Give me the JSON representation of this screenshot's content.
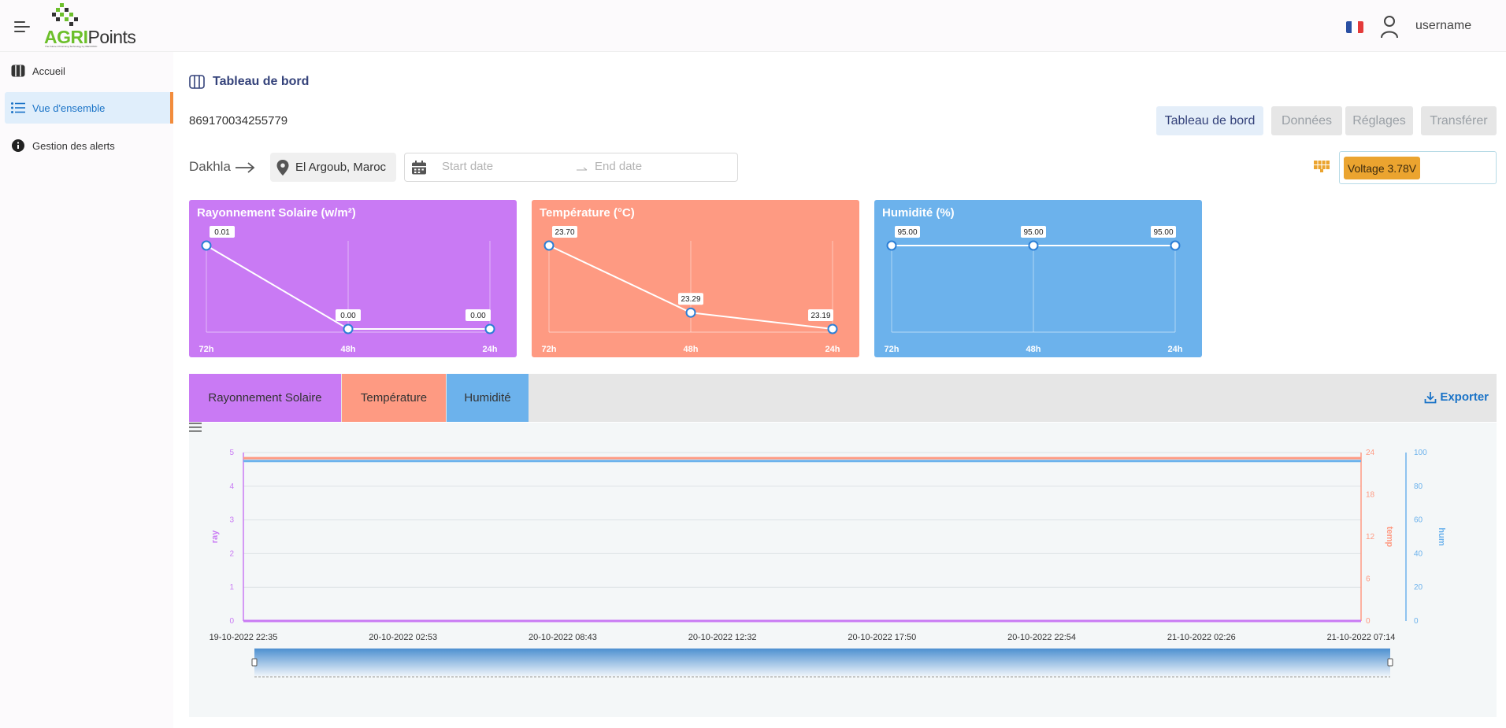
{
  "header": {
    "logo": {
      "agri": "AGRI",
      "points": "Points",
      "tagline": "The Future Of Farming Technology by WEVIONIC"
    },
    "flag_colors": [
      "#2a4fa3",
      "#ffffff",
      "#e43a3a"
    ],
    "username": "username"
  },
  "sidebar": {
    "items": [
      {
        "label": "Accueil",
        "icon": "columns-icon"
      },
      {
        "label": "Vue d'ensemble",
        "icon": "list-icon",
        "active": true
      },
      {
        "label": "Gestion des alerts",
        "icon": "info-icon"
      }
    ]
  },
  "page": {
    "title": "Tableau de bord",
    "device_id": "869170034255779",
    "tabs": [
      "Tableau de bord",
      "Données",
      "Réglages",
      "Transférer"
    ],
    "city": "Dakhla",
    "location": "El Argoub, Maroc",
    "start_placeholder": "Start date",
    "end_placeholder": "End date",
    "voltage": "Voltage 3.78V"
  },
  "colors": {
    "ray": "#c97af4",
    "temp": "#fe9a82",
    "hum": "#6cb2ec",
    "accent": "#1a73c7",
    "active_bar": "#f28c3c",
    "voltage": "#eba42f"
  },
  "cards": [
    {
      "title": "Rayonnement Solaire (w/m²)",
      "labels": [
        "72h",
        "48h",
        "24h"
      ],
      "values": [
        0.01,
        0.0,
        0.0
      ],
      "value_labels": [
        "0.01",
        "0.00",
        "0.00"
      ],
      "range": [
        0,
        0.01
      ]
    },
    {
      "title": "Température (°C)",
      "labels": [
        "72h",
        "48h",
        "24h"
      ],
      "values": [
        23.7,
        23.29,
        23.19
      ],
      "value_labels": [
        "23.70",
        "23.29",
        "23.19"
      ],
      "range": [
        23.19,
        23.7
      ]
    },
    {
      "title": "Humidité (%)",
      "labels": [
        "72h",
        "48h",
        "24h"
      ],
      "values": [
        95.0,
        95.0,
        95.0
      ],
      "value_labels": [
        "95.00",
        "95.00",
        "95.00"
      ],
      "range": [
        0,
        95
      ]
    }
  ],
  "chart_tabs": [
    "Rayonnement Solaire",
    "Température",
    "Humidité"
  ],
  "export_label": "Exporter",
  "chart_data": {
    "type": "line",
    "x": [
      "19-10-2022 22:35",
      "20-10-2022 02:53",
      "20-10-2022 08:43",
      "20-10-2022 12:32",
      "20-10-2022 17:50",
      "20-10-2022 22:54",
      "21-10-2022 02:26",
      "21-10-2022 07:14"
    ],
    "series": [
      {
        "name": "ray",
        "axis": "left",
        "values": [
          0,
          0,
          0,
          0,
          0,
          0,
          0,
          0
        ]
      },
      {
        "name": "temp",
        "axis": "right1",
        "values": [
          23.2,
          23.2,
          23.2,
          23.2,
          23.2,
          23.2,
          23.2,
          23.2
        ]
      },
      {
        "name": "hum",
        "axis": "right2",
        "values": [
          95,
          95,
          95,
          95,
          95,
          95,
          95,
          95
        ]
      }
    ],
    "axes": {
      "left": {
        "label": "ray",
        "ticks": [
          "0",
          "1",
          "2",
          "3",
          "4",
          "5"
        ],
        "range": [
          0,
          5
        ]
      },
      "right1": {
        "label": "temp",
        "ticks": [
          "0",
          "6",
          "12",
          "18",
          "24"
        ],
        "range": [
          0,
          24
        ]
      },
      "right2": {
        "label": "hum",
        "ticks": [
          "0",
          "20",
          "40",
          "60",
          "80",
          "100"
        ],
        "range": [
          0,
          100
        ]
      }
    },
    "grid": true
  }
}
